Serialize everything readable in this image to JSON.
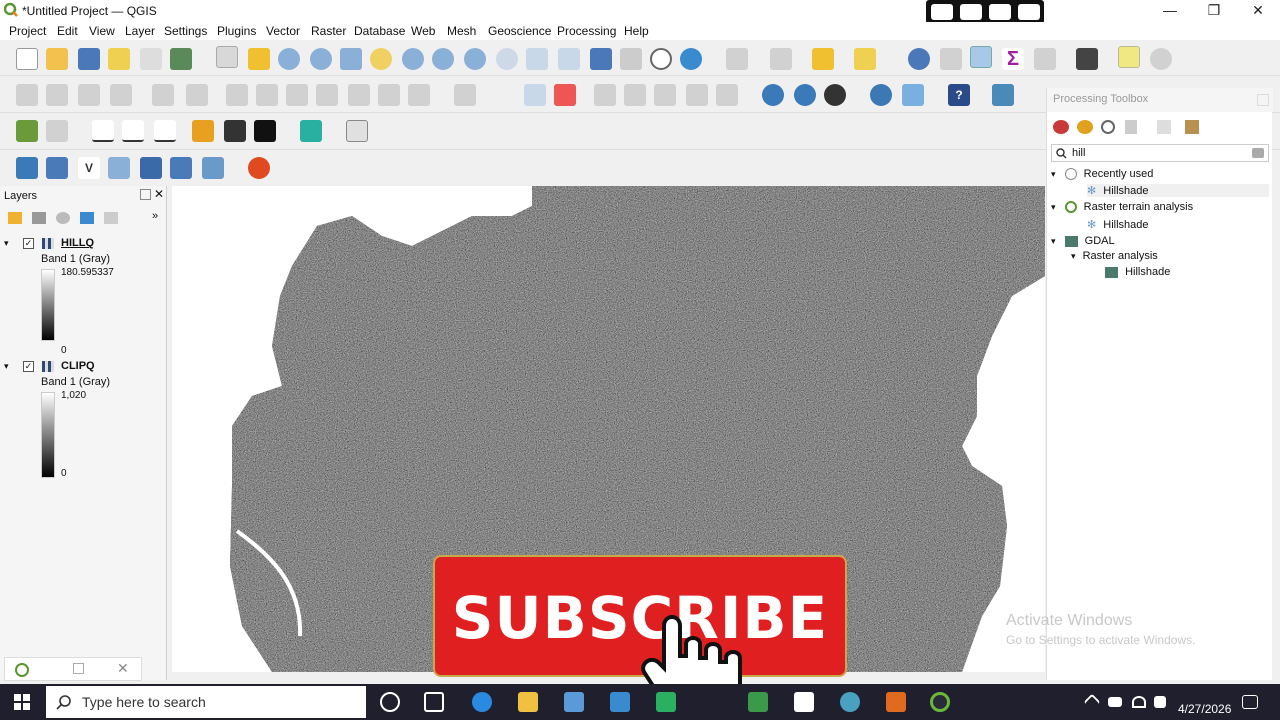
{
  "window": {
    "title": "*Untitled Project — QGIS",
    "minimize": "—",
    "restore": "❐",
    "close": "✕"
  },
  "menu": [
    "Project",
    "Edit",
    "View",
    "Layer",
    "Settings",
    "Plugins",
    "Vector",
    "Raster",
    "Database",
    "Web",
    "Mesh",
    "Geoscience",
    "Processing",
    "Help"
  ],
  "layers_panel": {
    "title": "Layers",
    "layers": [
      {
        "name": "HILLQ",
        "band": "Band 1 (Gray)",
        "max": "180.595337",
        "min": "0"
      },
      {
        "name": "CLIPQ",
        "band": "Band 1 (Gray)",
        "max": "1,020",
        "min": "0"
      }
    ]
  },
  "toolbox": {
    "title": "Processing Toolbox",
    "search_value": "hill",
    "groups": [
      {
        "label": "Recently used",
        "items": [
          "Hillshade"
        ]
      },
      {
        "label": "Raster terrain analysis",
        "items": [
          "Hillshade"
        ]
      },
      {
        "label": "GDAL",
        "subgroup": "Raster analysis",
        "items": [
          "Hillshade"
        ]
      }
    ]
  },
  "overlay": {
    "subscribe": "SUBSCRIBE"
  },
  "watermark": {
    "line1": "Activate Windows",
    "line2": "Go to Settings to activate Windows."
  },
  "taskbar": {
    "search_placeholder": "Type here to search",
    "date": "4/27/2026"
  },
  "colors": {
    "qgis_green": "#589632",
    "subscribe_red": "#e02020",
    "taskbar": "#1f1f2e"
  }
}
